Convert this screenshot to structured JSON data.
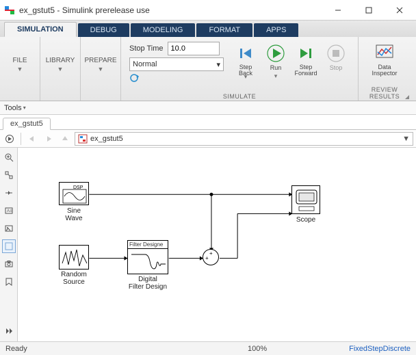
{
  "window": {
    "title": "ex_gstut5 - Simulink prerelease use"
  },
  "tabs": {
    "simulation": "SIMULATION",
    "debug": "DEBUG",
    "modeling": "MODELING",
    "format": "FORMAT",
    "apps": "APPS"
  },
  "toolstrip": {
    "file": "FILE",
    "library": "LIBRARY",
    "prepare": "PREPARE",
    "stopTimeLabel": "Stop Time",
    "stopTimeValue": "10.0",
    "mode": "Normal",
    "stepBack": "Step\nBack",
    "run": "Run",
    "stepForward": "Step\nForward",
    "stop": "Stop",
    "dataInspector": "Data\nInspector",
    "simulateLabel": "SIMULATE",
    "reviewLabel": "REVIEW RESULTS"
  },
  "toolsbar": {
    "label": "Tools"
  },
  "modelTab": "ex_gstut5",
  "breadcrumb": {
    "text": "ex_gstut5"
  },
  "blocks": {
    "sineWave": {
      "label": "Sine Wave",
      "tag": "DSP"
    },
    "randomSource": {
      "label": "Random\nSource"
    },
    "filterDesign": {
      "label": "Digital\nFilter Design",
      "inner": "Filter Designe"
    },
    "scope": {
      "label": "Scope"
    }
  },
  "status": {
    "ready": "Ready",
    "zoom": "100%",
    "solver": "FixedStepDiscrete"
  }
}
